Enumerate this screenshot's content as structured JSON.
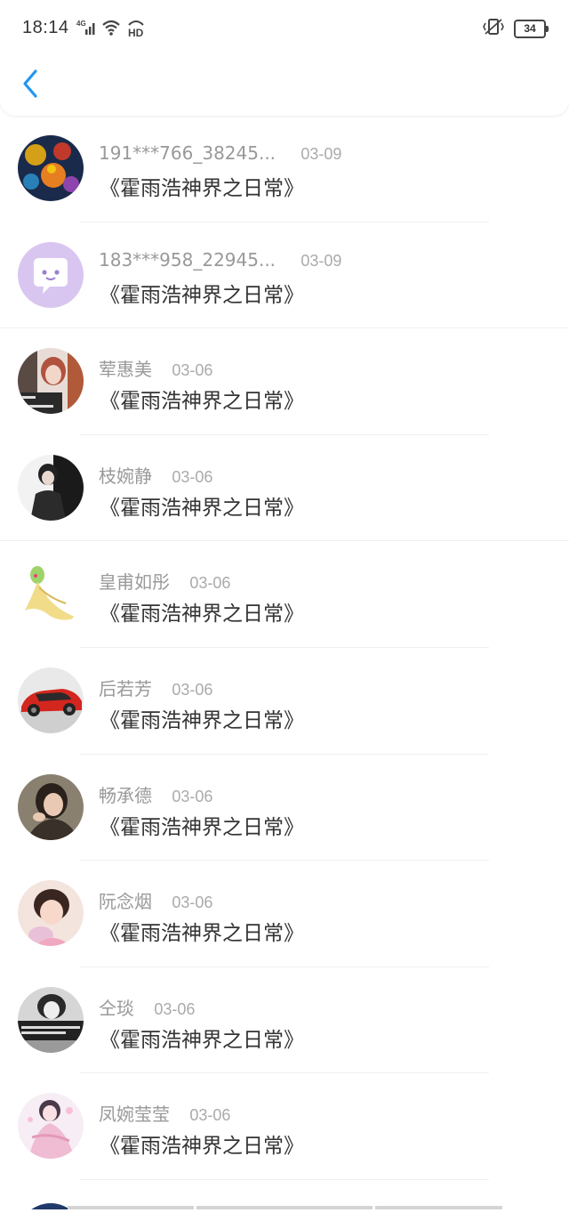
{
  "status_bar": {
    "time": "18:14",
    "network": "4G",
    "hd": "HD",
    "battery": "34",
    "icons": [
      "signal-icon",
      "wifi-icon",
      "hd-icon",
      "vibrate-icon",
      "battery-icon"
    ]
  },
  "header": {
    "back_icon": "chevron-left-icon",
    "accent": "#2196f3"
  },
  "items": [
    {
      "name": "191***766_38245...",
      "date": "03-09",
      "title": "《霍雨浩神界之日常》",
      "avatar": "colorful-art"
    },
    {
      "name": "183***958_22945...",
      "date": "03-09",
      "title": "《霍雨浩神界之日常》",
      "avatar": "purple-chat"
    },
    {
      "name": "荤惠美",
      "date": "03-06",
      "title": "《霍雨浩神界之日常》",
      "avatar": "girl-photo"
    },
    {
      "name": "枝婉静",
      "date": "03-06",
      "title": "《霍雨浩神界之日常》",
      "avatar": "person-dark"
    },
    {
      "name": "皇甫如彤",
      "date": "03-06",
      "title": "《霍雨浩神界之日常》",
      "avatar": "yellow-figure"
    },
    {
      "name": "后若芳",
      "date": "03-06",
      "title": "《霍雨浩神界之日常》",
      "avatar": "red-car"
    },
    {
      "name": "畅承德",
      "date": "03-06",
      "title": "《霍雨浩神界之日常》",
      "avatar": "woman-photo"
    },
    {
      "name": "阮念烟",
      "date": "03-06",
      "title": "《霍雨浩神界之日常》",
      "avatar": "girl-pink"
    },
    {
      "name": "仝琰",
      "date": "03-06",
      "title": "《霍雨浩神界之日常》",
      "avatar": "bw-photo"
    },
    {
      "name": "凤婉莹莹",
      "date": "03-06",
      "title": "《霍雨浩神界之日常》",
      "avatar": "anime-girl"
    }
  ]
}
